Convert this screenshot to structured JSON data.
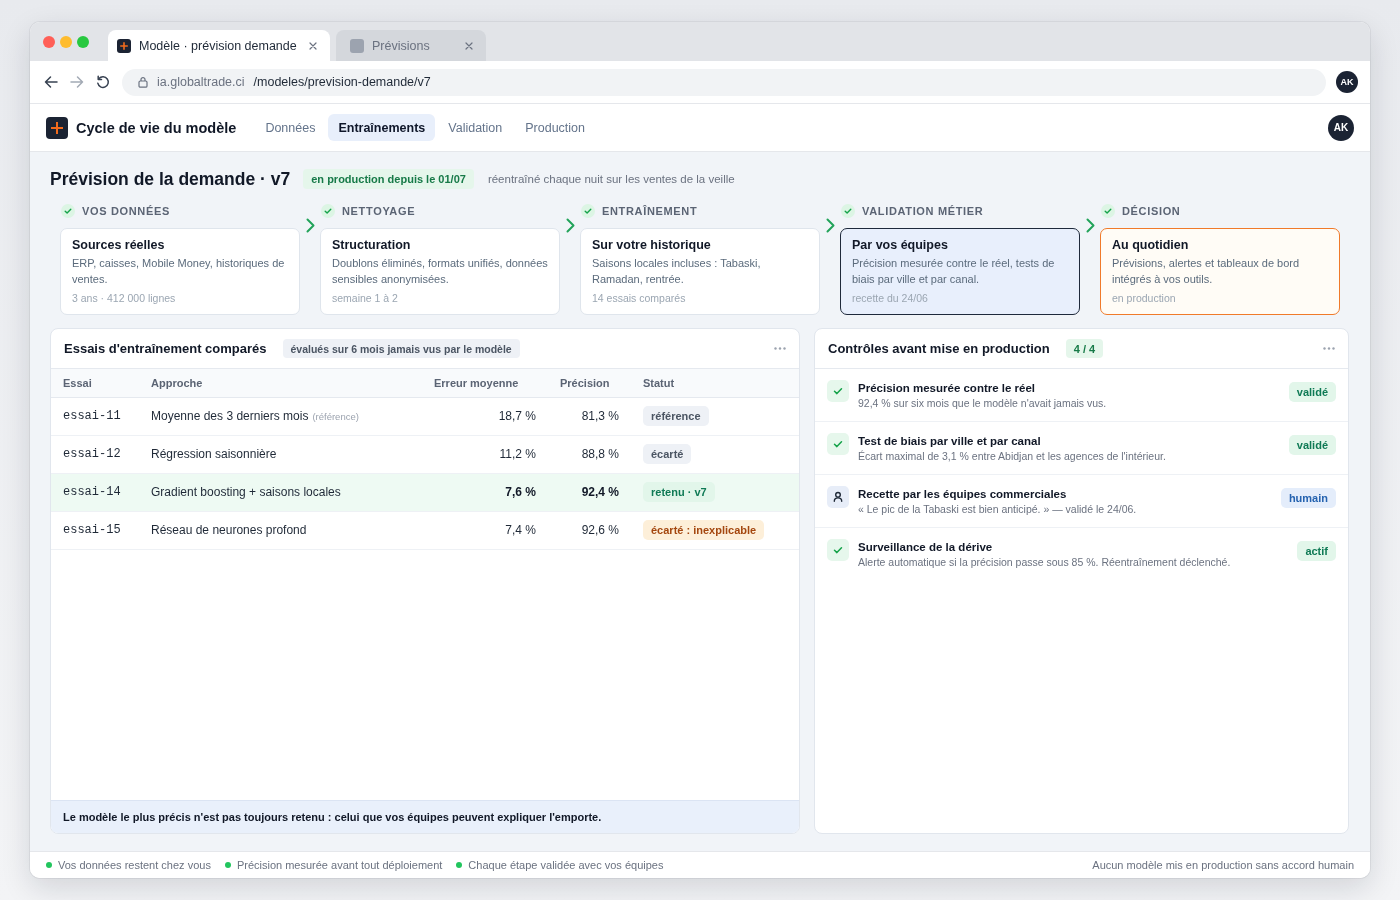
{
  "browser": {
    "tabs": [
      {
        "title": "Modèle · prévision demande",
        "selected": true
      },
      {
        "title": "Prévisions",
        "selected": false
      }
    ],
    "address": {
      "host": "ia.globaltrade.ci",
      "path": "/modeles/prevision-demande/v7"
    },
    "profile": "AK"
  },
  "app_bar": {
    "title": "Cycle de vie du modèle",
    "nav": [
      {
        "label": "Données",
        "selected": false
      },
      {
        "label": "Entraînements",
        "selected": true
      },
      {
        "label": "Validation",
        "selected": false
      },
      {
        "label": "Production",
        "selected": false
      }
    ],
    "user": "AK"
  },
  "header": {
    "title": "Prévision de la demande · v7",
    "badge": "en production depuis le 01/07",
    "note": "réentraîné chaque nuit sur les ventes de la veille"
  },
  "pipeline": [
    {
      "step": "VOS DONNÉES",
      "done": true,
      "kind": "plain",
      "title": "Sources réelles",
      "description": "ERP, caisses, Mobile Money, historiques de ventes.",
      "meta": "3 ans · 412 000 lignes"
    },
    {
      "step": "NETTOYAGE",
      "done": true,
      "kind": "plain",
      "title": "Structuration",
      "description": "Doublons éliminés, formats unifiés, données sensibles anonymisées.",
      "meta": "semaine 1 à 2"
    },
    {
      "step": "ENTRAÎNEMENT",
      "done": true,
      "kind": "plain",
      "title": "Sur votre historique",
      "description": "Saisons locales incluses : Tabaski, Ramadan, rentrée.",
      "meta": "14 essais comparés"
    },
    {
      "step": "VALIDATION MÉTIER",
      "done": true,
      "kind": "review",
      "title": "Par vos équipes",
      "description": "Précision mesurée contre le réel, tests de biais par ville et par canal.",
      "meta": "recette du 24/06"
    },
    {
      "step": "DÉCISION",
      "done": true,
      "kind": "outcome",
      "title": "Au quotidien",
      "description": "Prévisions, alertes et tableaux de bord intégrés à vos outils.",
      "meta": "en production"
    }
  ],
  "trials": {
    "title": "Essais d'entraînement comparés",
    "chip": "évalués sur 6 mois jamais vus par le modèle",
    "columns": [
      "Essai",
      "Approche",
      "Erreur moyenne",
      "Précision",
      "Statut"
    ],
    "rows": [
      {
        "id": "essai-11",
        "approach": "Moyenne des 3 derniers mois",
        "approach_note": "(référence)",
        "error": "18,7 %",
        "precision": "81,3 %",
        "status": {
          "label": "référence",
          "kind": "neutral"
        },
        "selected": false
      },
      {
        "id": "essai-12",
        "approach": "Régression saisonnière",
        "error": "11,2 %",
        "precision": "88,8 %",
        "status": {
          "label": "écarté",
          "kind": "neutral"
        },
        "selected": false
      },
      {
        "id": "essai-14",
        "approach": "Gradient boosting + saisons locales",
        "error": "7,6 %",
        "precision": "92,4 %",
        "status": {
          "label": "retenu · v7",
          "kind": "success"
        },
        "selected": true
      },
      {
        "id": "essai-15",
        "approach": "Réseau de neurones profond",
        "error": "7,4 %",
        "precision": "92,6 %",
        "status": {
          "label": "écarté : inexplicable",
          "kind": "warning"
        },
        "selected": false
      }
    ],
    "footnote": "Le modèle le plus précis n'est pas toujours retenu : celui que vos équipes peuvent expliquer l'emporte."
  },
  "checks": {
    "title": "Contrôles avant mise en production",
    "count": "4 / 4",
    "items": [
      {
        "kind": "check",
        "title": "Précision mesurée contre le réel",
        "detail": "92,4 % sur six mois que le modèle n'avait jamais vus.",
        "badge": {
          "label": "validé",
          "kind": "success"
        }
      },
      {
        "kind": "check",
        "title": "Test de biais par ville et par canal",
        "detail": "Écart maximal de 3,1 % entre Abidjan et les agences de l'intérieur.",
        "badge": {
          "label": "validé",
          "kind": "success"
        }
      },
      {
        "kind": "human",
        "title": "Recette par les équipes commerciales",
        "detail": "« Le pic de la Tabaski est bien anticipé. » — validé le 24/06.",
        "badge": {
          "label": "humain",
          "kind": "info"
        }
      },
      {
        "kind": "check",
        "title": "Surveillance de la dérive",
        "detail": "Alerte automatique si la précision passe sous 85 %. Réentraînement déclenché.",
        "badge": {
          "label": "actif",
          "kind": "success"
        }
      }
    ]
  },
  "status_bar": {
    "items": [
      "Vos données restent chez vous",
      "Précision mesurée avant tout déploiement",
      "Chaque étape validée avec vos équipes"
    ],
    "note": "Aucun modèle mis en production sans accord humain"
  }
}
